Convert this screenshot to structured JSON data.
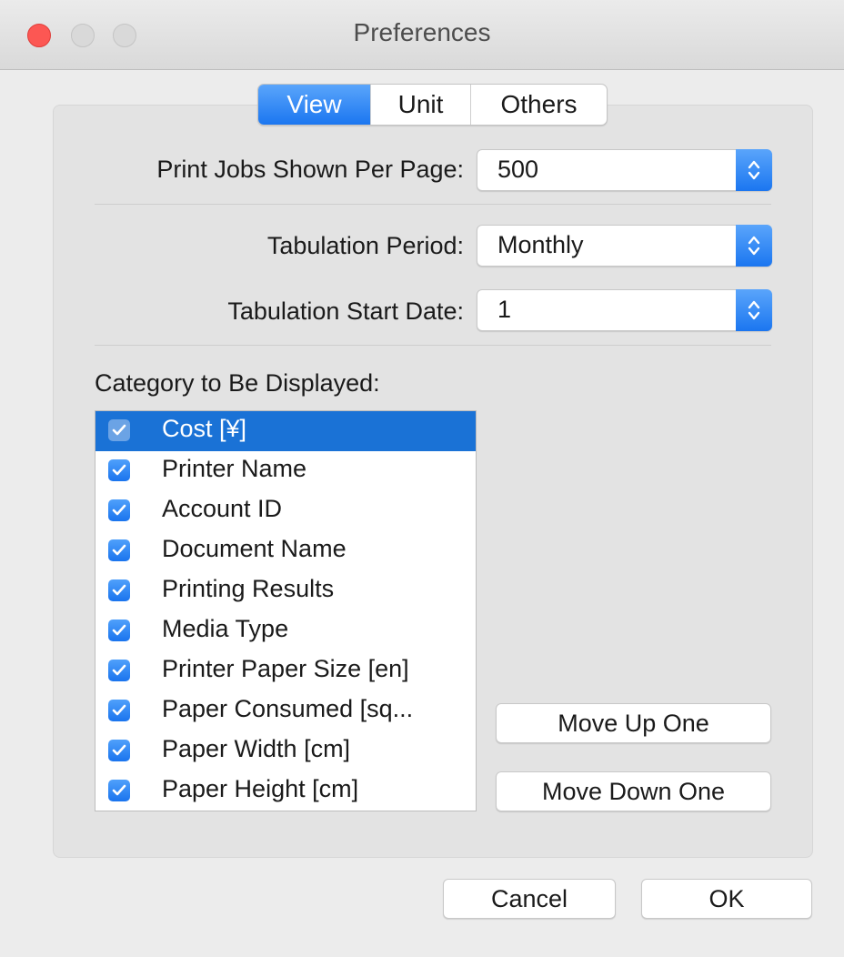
{
  "window": {
    "title": "Preferences"
  },
  "tabs": [
    {
      "label": "View",
      "active": true
    },
    {
      "label": "Unit",
      "active": false
    },
    {
      "label": "Others",
      "active": false
    }
  ],
  "settings": {
    "jobs_per_page": {
      "label": "Print Jobs Shown Per Page:",
      "value": "500"
    },
    "tabulation_period": {
      "label": "Tabulation Period:",
      "value": "Monthly"
    },
    "tabulation_start_date": {
      "label": "Tabulation Start Date:",
      "value": "1"
    }
  },
  "category": {
    "label": "Category to Be Displayed:",
    "items": [
      {
        "label": "Cost [¥]",
        "checked": true,
        "selected": true
      },
      {
        "label": "Printer Name",
        "checked": true,
        "selected": false
      },
      {
        "label": "Account ID",
        "checked": true,
        "selected": false
      },
      {
        "label": "Document Name",
        "checked": true,
        "selected": false
      },
      {
        "label": "Printing Results",
        "checked": true,
        "selected": false
      },
      {
        "label": "Media Type",
        "checked": true,
        "selected": false
      },
      {
        "label": "Printer Paper Size [en]",
        "checked": true,
        "selected": false
      },
      {
        "label": "Paper Consumed [sq...",
        "checked": true,
        "selected": false
      },
      {
        "label": "Paper Width [cm]",
        "checked": true,
        "selected": false
      },
      {
        "label": "Paper Height [cm]",
        "checked": true,
        "selected": false
      }
    ]
  },
  "buttons": {
    "move_up": "Move Up One",
    "move_down": "Move Down One",
    "cancel": "Cancel",
    "ok": "OK"
  },
  "colors": {
    "accent": "#1b76f0",
    "selection": "#1a72d6",
    "close": "#fc5753"
  }
}
